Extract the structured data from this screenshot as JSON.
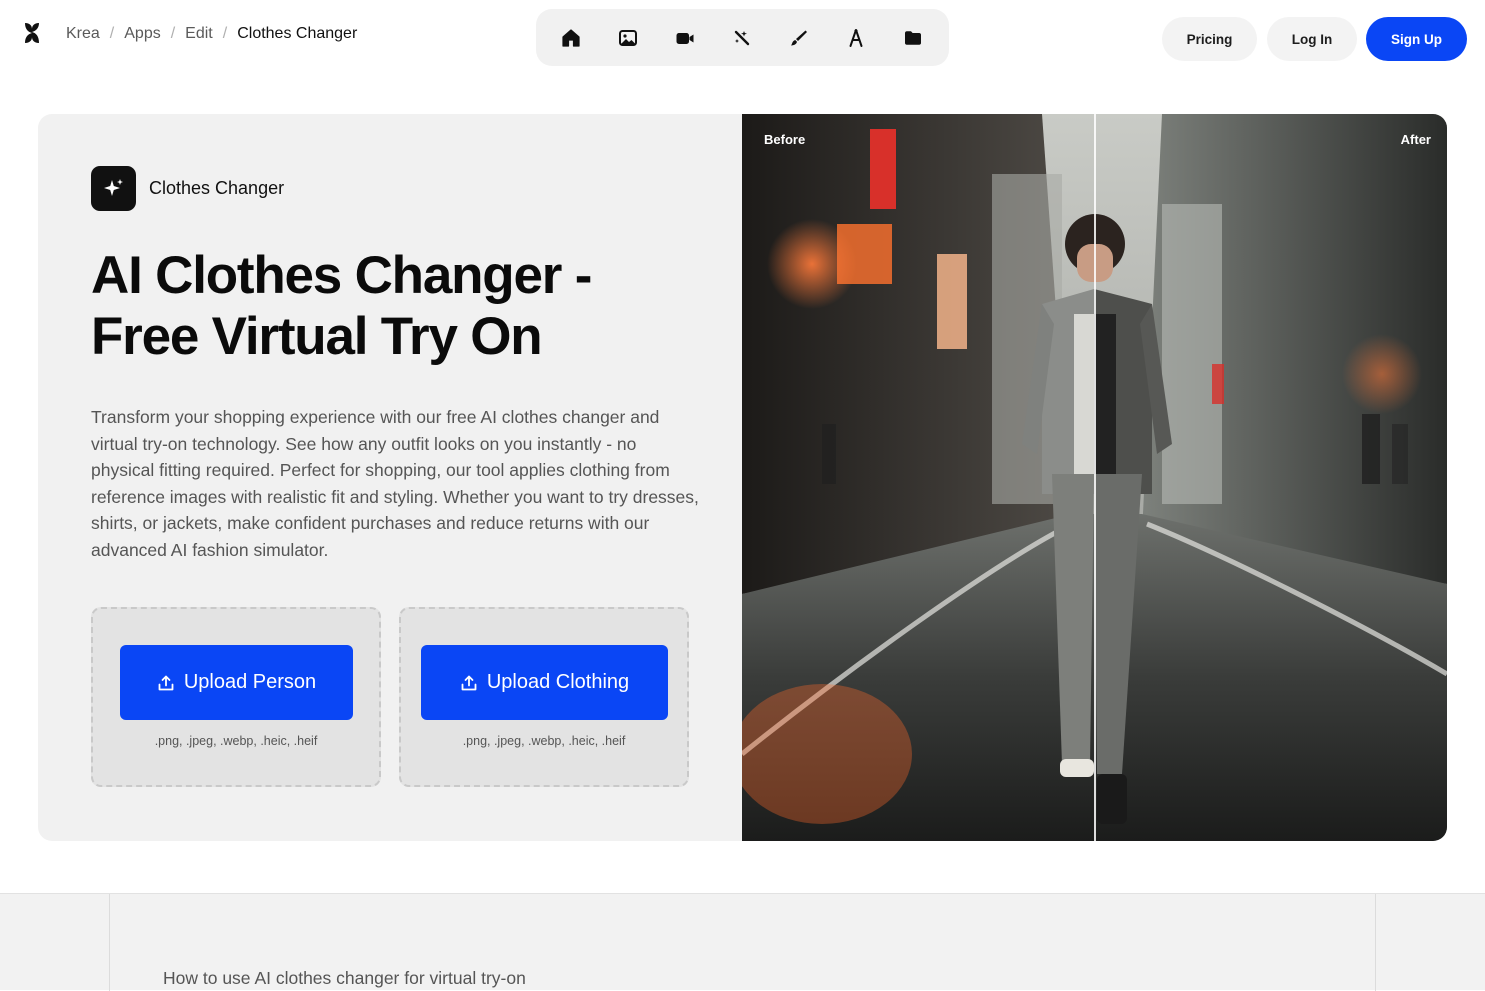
{
  "breadcrumb": {
    "items": [
      "Krea",
      "Apps",
      "Edit"
    ],
    "current": "Clothes Changer"
  },
  "toolbar": {
    "icons": [
      "home-icon",
      "image-icon",
      "video-icon",
      "enhance-icon",
      "edit-brush-icon",
      "train-icon",
      "folder-icon"
    ]
  },
  "nav": {
    "pricing": "Pricing",
    "login": "Log In",
    "signup": "Sign Up"
  },
  "hero": {
    "app_name": "Clothes Changer",
    "title_line1": "AI Clothes Changer -",
    "title_line2": "Free Virtual Try On",
    "description": "Transform your shopping experience with our free AI clothes changer and virtual try-on technology. See how any outfit looks on you instantly - no physical fitting required. Perfect for shopping, our tool applies clothing from reference images with realistic fit and styling. Whether you want to try dresses, shirts, or jackets, make confident purchases and reduce returns with our advanced AI fashion simulator.",
    "upload_person": "Upload Person",
    "upload_clothing": "Upload Clothing",
    "formats_person": ".png, .jpeg, .webp, .heic, .heif",
    "formats_clothing": ".png, .jpeg, .webp, .heic, .heif"
  },
  "compare": {
    "before_label": "Before",
    "after_label": "After"
  },
  "lower": {
    "section_title": "How to use AI clothes changer for virtual try-on"
  },
  "colors": {
    "accent": "#0a46f5",
    "card_bg": "#f1f1f1"
  }
}
